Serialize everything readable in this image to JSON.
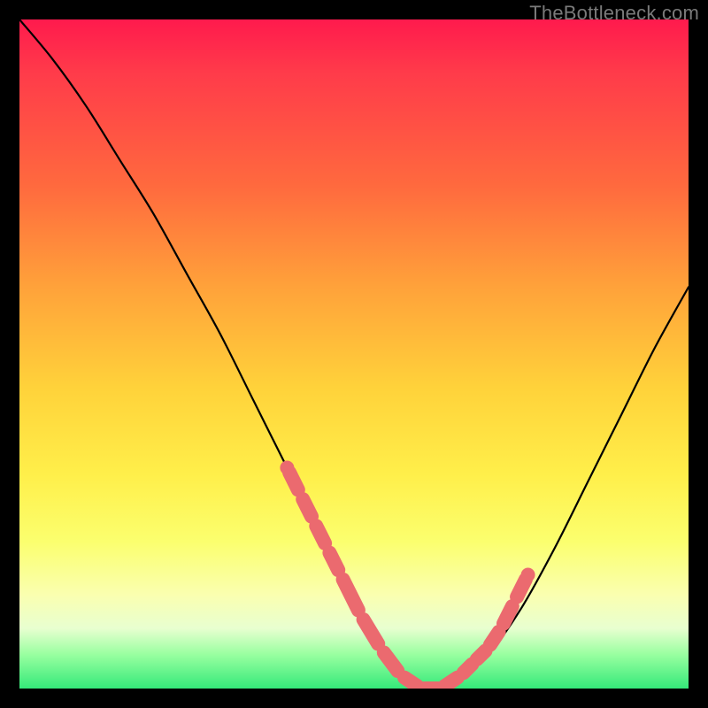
{
  "watermark": "TheBottleneck.com",
  "colors": {
    "background": "#000000",
    "curve": "#000000",
    "marker": "#eb6a6f",
    "gradient_stops": [
      "#ff1a4d",
      "#ff6a3e",
      "#ffd23a",
      "#fbff6e",
      "#35e97a"
    ]
  },
  "chart_data": {
    "type": "line",
    "title": "",
    "xlabel": "",
    "ylabel": "",
    "xlim": [
      0,
      100
    ],
    "ylim": [
      0,
      100
    ],
    "grid": false,
    "legend": false,
    "series": [
      {
        "name": "bottleneck-curve",
        "x": [
          0,
          5,
          10,
          15,
          20,
          25,
          30,
          35,
          40,
          45,
          50,
          55,
          58,
          60,
          63,
          65,
          70,
          75,
          80,
          85,
          90,
          95,
          100
        ],
        "y": [
          100,
          94,
          87,
          79,
          71,
          62,
          53,
          43,
          33,
          23,
          13,
          5,
          2,
          0,
          0,
          1,
          5,
          12,
          21,
          31,
          41,
          51,
          60
        ]
      }
    ],
    "markers": {
      "name": "highlighted-segment",
      "color": "#eb6a6f",
      "x": [
        40,
        42,
        44,
        46,
        48,
        51,
        54,
        57,
        60,
        63,
        66,
        68,
        70,
        72,
        74,
        76
      ],
      "y": [
        33,
        29,
        25,
        21,
        17,
        11,
        6,
        2,
        0,
        0,
        2,
        4,
        6,
        9,
        13,
        17
      ]
    },
    "annotations": []
  }
}
